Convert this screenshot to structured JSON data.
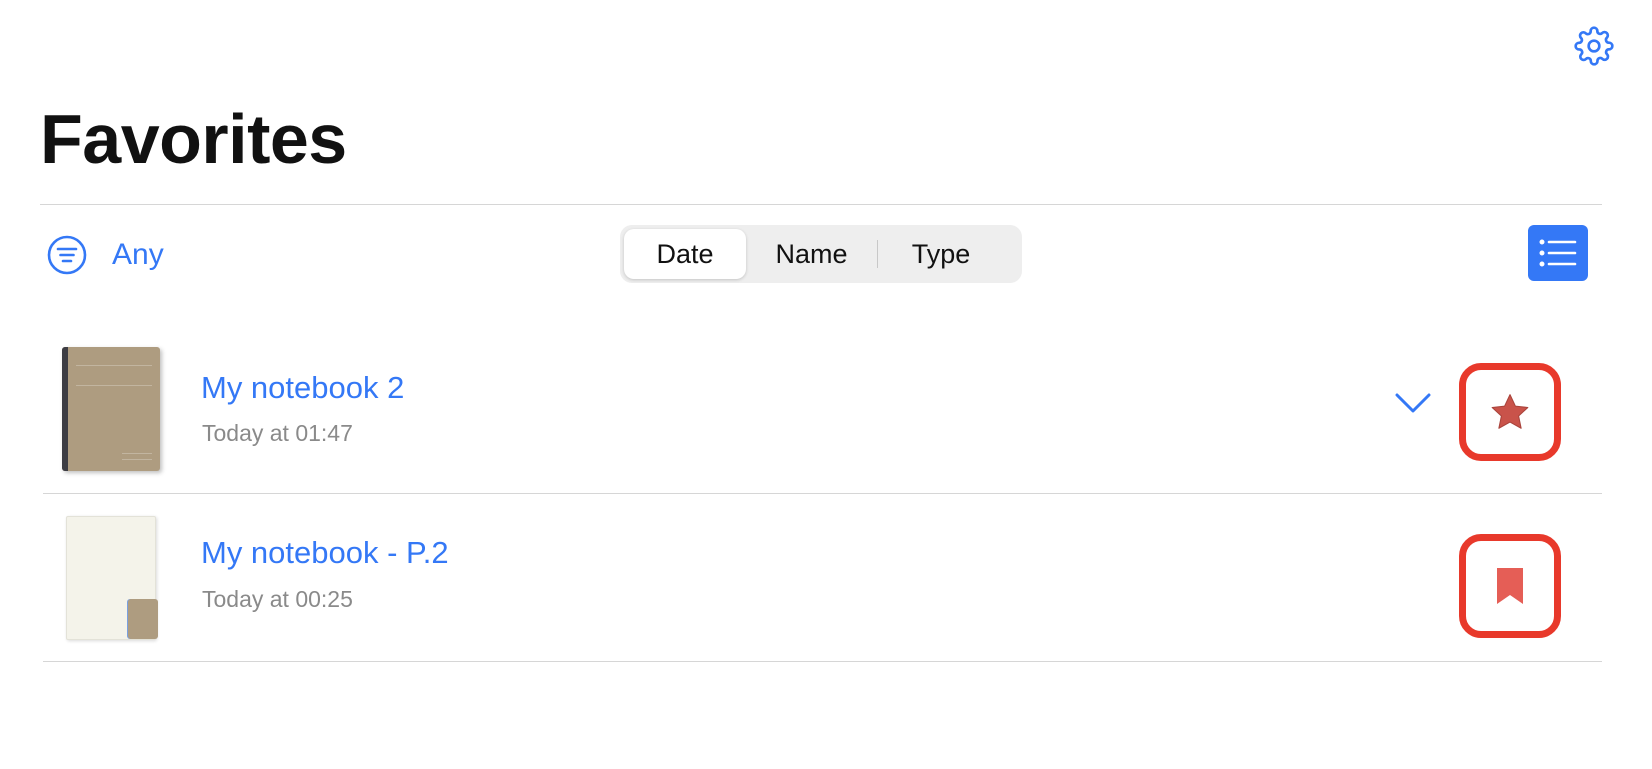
{
  "header": {
    "settings_icon": "gear-icon",
    "title": "Favorites"
  },
  "toolbar": {
    "filter_icon": "filter-lines-icon",
    "filter_label": "Any",
    "sort_options": [
      "Date",
      "Name",
      "Type"
    ],
    "sort_selected": "Date",
    "view_toggle_icon": "list-view-icon"
  },
  "items": [
    {
      "title": "My notebook 2",
      "subtitle": "Today at 01:47",
      "thumbnail": "notebook-cover",
      "expand_icon": "chevron-down-icon",
      "action_icon": "star-icon"
    },
    {
      "title": "My notebook - P.2",
      "subtitle": "Today at 00:25",
      "thumbnail": "page",
      "action_icon": "bookmark-icon"
    }
  ],
  "colors": {
    "accent": "#3478f6",
    "favorite_star": "#c9534a",
    "bookmark": "#e55e56",
    "highlight_box": "#e8392b",
    "notebook_cover": "#ae9c80"
  }
}
